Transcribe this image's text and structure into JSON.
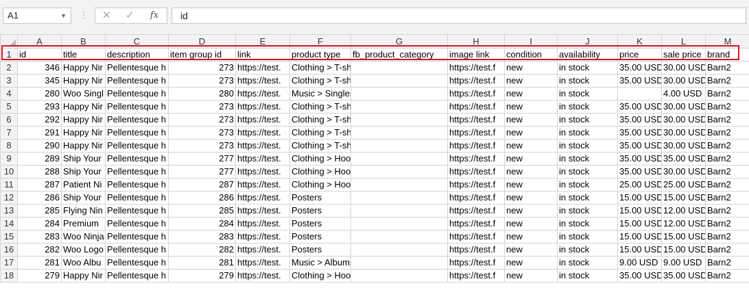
{
  "formula_bar": {
    "name_box": "A1",
    "cancel_icon": "✕",
    "enter_icon": "✓",
    "fx_label": "fx",
    "value": "id"
  },
  "columns": [
    "A",
    "B",
    "C",
    "D",
    "E",
    "F",
    "G",
    "H",
    "I",
    "J",
    "K",
    "L",
    "M"
  ],
  "rows": [
    {
      "n": "1",
      "c": [
        "id",
        "title",
        "description",
        "item group id",
        "link",
        "product type",
        "fb_product_category",
        "image link",
        "condition",
        "availability",
        "price",
        "sale price",
        "brand"
      ]
    },
    {
      "n": "2",
      "c": [
        "346",
        "Happy Nir",
        "Pellentesque h",
        "273",
        "https://test.",
        "Clothing > T-shirts",
        "",
        "https://test.f",
        "new",
        "in stock",
        "35.00 USD",
        "30.00 USD",
        "Barn2"
      ]
    },
    {
      "n": "3",
      "c": [
        "345",
        "Happy Nir",
        "Pellentesque h",
        "273",
        "https://test.",
        "Clothing > T-shirts",
        "",
        "https://test.f",
        "new",
        "in stock",
        "35.00 USD",
        "30.00 USD",
        "Barn2"
      ]
    },
    {
      "n": "4",
      "c": [
        "280",
        "Woo Singl",
        "Pellentesque h",
        "280",
        "https://test.",
        "Music > Singles",
        "",
        "https://test.f",
        "new",
        "in stock",
        "",
        "4.00 USD",
        "Barn2"
      ]
    },
    {
      "n": "5",
      "c": [
        "293",
        "Happy Nir",
        "Pellentesque h",
        "273",
        "https://test.",
        "Clothing > T-shirts",
        "",
        "https://test.f",
        "new",
        "in stock",
        "35.00 USD",
        "30.00 USD",
        "Barn2"
      ]
    },
    {
      "n": "6",
      "c": [
        "292",
        "Happy Nir",
        "Pellentesque h",
        "273",
        "https://test.",
        "Clothing > T-shirts",
        "",
        "https://test.f",
        "new",
        "in stock",
        "35.00 USD",
        "30.00 USD",
        "Barn2"
      ]
    },
    {
      "n": "7",
      "c": [
        "291",
        "Happy Nir",
        "Pellentesque h",
        "273",
        "https://test.",
        "Clothing > T-shirts",
        "",
        "https://test.f",
        "new",
        "in stock",
        "35.00 USD",
        "30.00 USD",
        "Barn2"
      ]
    },
    {
      "n": "8",
      "c": [
        "290",
        "Happy Nir",
        "Pellentesque h",
        "273",
        "https://test.",
        "Clothing > T-shirts",
        "",
        "https://test.f",
        "new",
        "in stock",
        "35.00 USD",
        "30.00 USD",
        "Barn2"
      ]
    },
    {
      "n": "9",
      "c": [
        "289",
        "Ship Your",
        "Pellentesque h",
        "277",
        "https://test.",
        "Clothing > Hoodies",
        "",
        "https://test.f",
        "new",
        "in stock",
        "35.00 USD",
        "35.00 USD",
        "Barn2"
      ]
    },
    {
      "n": "10",
      "c": [
        "288",
        "Ship Your",
        "Pellentesque h",
        "277",
        "https://test.",
        "Clothing > Hoodies",
        "",
        "https://test.f",
        "new",
        "in stock",
        "35.00 USD",
        "30.00 USD",
        "Barn2"
      ]
    },
    {
      "n": "11",
      "c": [
        "287",
        "Patient Ni",
        "Pellentesque h",
        "287",
        "https://test.",
        "Clothing > Hoodies",
        "",
        "https://test.f",
        "new",
        "in stock",
        "25.00 USD",
        "25.00 USD",
        "Barn2"
      ]
    },
    {
      "n": "12",
      "c": [
        "286",
        "Ship Your",
        "Pellentesque h",
        "286",
        "https://test.",
        "Posters",
        "",
        "https://test.f",
        "new",
        "in stock",
        "15.00 USD",
        "15.00 USD",
        "Barn2"
      ]
    },
    {
      "n": "13",
      "c": [
        "285",
        "Flying Nin",
        "Pellentesque h",
        "285",
        "https://test.",
        "Posters",
        "",
        "https://test.f",
        "new",
        "in stock",
        "15.00 USD",
        "12.00 USD",
        "Barn2"
      ]
    },
    {
      "n": "14",
      "c": [
        "284",
        "Premium",
        "Pellentesque h",
        "284",
        "https://test.",
        "Posters",
        "",
        "https://test.f",
        "new",
        "in stock",
        "15.00 USD",
        "12.00 USD",
        "Barn2"
      ]
    },
    {
      "n": "15",
      "c": [
        "283",
        "Woo Ninja",
        "Pellentesque h",
        "283",
        "https://test.",
        "Posters",
        "",
        "https://test.f",
        "new",
        "in stock",
        "15.00 USD",
        "15.00 USD",
        "Barn2"
      ]
    },
    {
      "n": "16",
      "c": [
        "282",
        "Woo Logo",
        "Pellentesque h",
        "282",
        "https://test.",
        "Posters",
        "",
        "https://test.f",
        "new",
        "in stock",
        "15.00 USD",
        "15.00 USD",
        "Barn2"
      ]
    },
    {
      "n": "17",
      "c": [
        "281",
        "Woo Albu",
        "Pellentesque h",
        "281",
        "https://test.",
        "Music > Albums",
        "",
        "https://test.f",
        "new",
        "in stock",
        "9.00 USD",
        "9.00 USD",
        "Barn2"
      ]
    },
    {
      "n": "18",
      "c": [
        "279",
        "Happy Nir",
        "Pellentesque h",
        "279",
        "https://test.",
        "Clothing > Hoodies",
        "",
        "https://test.f",
        "new",
        "in stock",
        "35.00 USD",
        "35.00 USD",
        "Barn2"
      ]
    }
  ],
  "highlight_color": "#e0101a"
}
